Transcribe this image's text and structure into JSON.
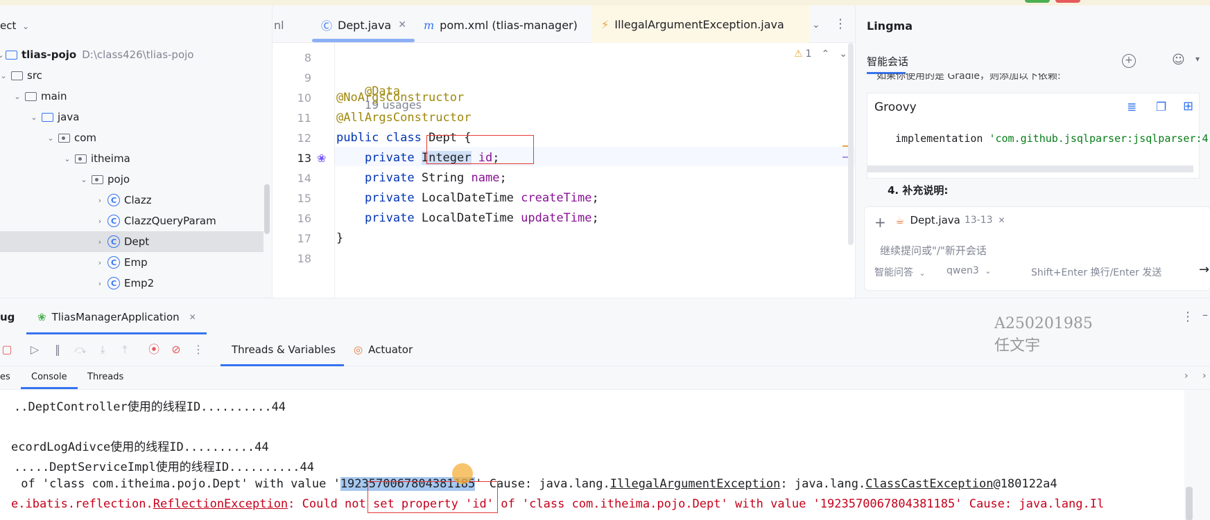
{
  "colors": {
    "accent": "#3574f0",
    "annotation": "#9e880d",
    "keyword": "#0033b3",
    "field": "#871094",
    "error": "#c4001a",
    "highlight_box": "#e53935",
    "selection": "#cfe0f7"
  },
  "project": {
    "header": "ect",
    "items": [
      {
        "label": "tlias-pojo",
        "hint": "D:\\class426\\tlias-pojo",
        "icon": "module-folder-icon"
      },
      {
        "label": "src",
        "icon": "folder-icon"
      },
      {
        "label": "main",
        "icon": "folder-icon"
      },
      {
        "label": "java",
        "icon": "source-folder-icon"
      },
      {
        "label": "com",
        "icon": "package-icon"
      },
      {
        "label": "itheima",
        "icon": "package-icon"
      },
      {
        "label": "pojo",
        "icon": "package-icon"
      },
      {
        "label": "Clazz",
        "icon": "class-icon"
      },
      {
        "label": "ClazzQueryParam",
        "icon": "class-icon"
      },
      {
        "label": "Dept",
        "icon": "class-icon",
        "selected": true
      },
      {
        "label": "Emp",
        "icon": "class-icon"
      },
      {
        "label": "Emp2",
        "icon": "class-icon"
      }
    ]
  },
  "editor_tabs": [
    {
      "label": "nl"
    },
    {
      "label": "Dept.java",
      "active": true
    },
    {
      "label": "pom.xml (tlias-manager)"
    },
    {
      "label": "IllegalArgumentException.java"
    }
  ],
  "editor": {
    "warning_count": "1",
    "line_numbers": [
      "8",
      "9",
      "10",
      "11",
      "12",
      "13",
      "14",
      "15",
      "16",
      "17",
      "18"
    ],
    "code": {
      "l9_annotation": "@Data",
      "l9_hint": "19 usages",
      "l10": "@NoArgsConstructor",
      "l11": "@AllArgsConstructor",
      "l12_kw": "public class ",
      "l12_rest": "Dept {",
      "l13_kw": "private ",
      "l13_type": "Integer",
      "l13_field": "id",
      "l14_kw": "private ",
      "l14_type": "String ",
      "l14_field": "name",
      "l15_kw": "private ",
      "l15_type": "LocalDateTime ",
      "l15_field": "createTime",
      "l16_kw": "private ",
      "l16_type": "LocalDateTime ",
      "l16_field": "updateTime",
      "semicolon": ";",
      "l17": "}"
    }
  },
  "lingma": {
    "title": "Lingma",
    "tab": "智能会话",
    "cut_text": "如果你使用的是 Gradle，则添加以下依赖:",
    "code_lang": "Groovy",
    "code_line_kw": "implementation ",
    "code_line_str": "'com.github.jsqlparser:jsqlparser:4",
    "section": "4. 补充说明:",
    "context_file": "Dept.java",
    "context_range": "13-13",
    "input_placeholder": "继续提问或\"/\"新开会话",
    "mode": "智能问答",
    "model": "qwen3",
    "send_hint": "Shift+Enter 换行/Enter 发送"
  },
  "debug": {
    "label": "ug",
    "run_config": "TliasManagerApplication",
    "tabs": [
      "Threads & Variables",
      "Actuator"
    ],
    "subtabs": [
      "es",
      "Console",
      "Threads"
    ],
    "watermark": [
      "A250201985",
      "任文宇"
    ],
    "console_lines": [
      "..DeptController使用的线程ID..........44",
      "",
      "ecordLogAdivce使用的线程ID..........44",
      ".....DeptServiceImpl使用的线程ID..........44"
    ],
    "err_line1_a": " of 'class com.itheima.pojo.Dept' with value '",
    "err_line1_value": "1923570067804381185",
    "err_line1_b": "' Cause: java.lang.",
    "err_line1_ex1": "IllegalArgumentException",
    "err_line1_c": ": java.lang.",
    "err_line1_ex2": "ClassCastException",
    "err_line1_d": "@180122a4",
    "err_line2_a": "e.ibatis.reflection.",
    "err_line2_ex": "ReflectionException",
    "err_line2_b": ": Could not set property 'id' of 'class com.itheima.pojo.Dept' with value '1923570067804381185' Cause: java.lang.Il"
  }
}
